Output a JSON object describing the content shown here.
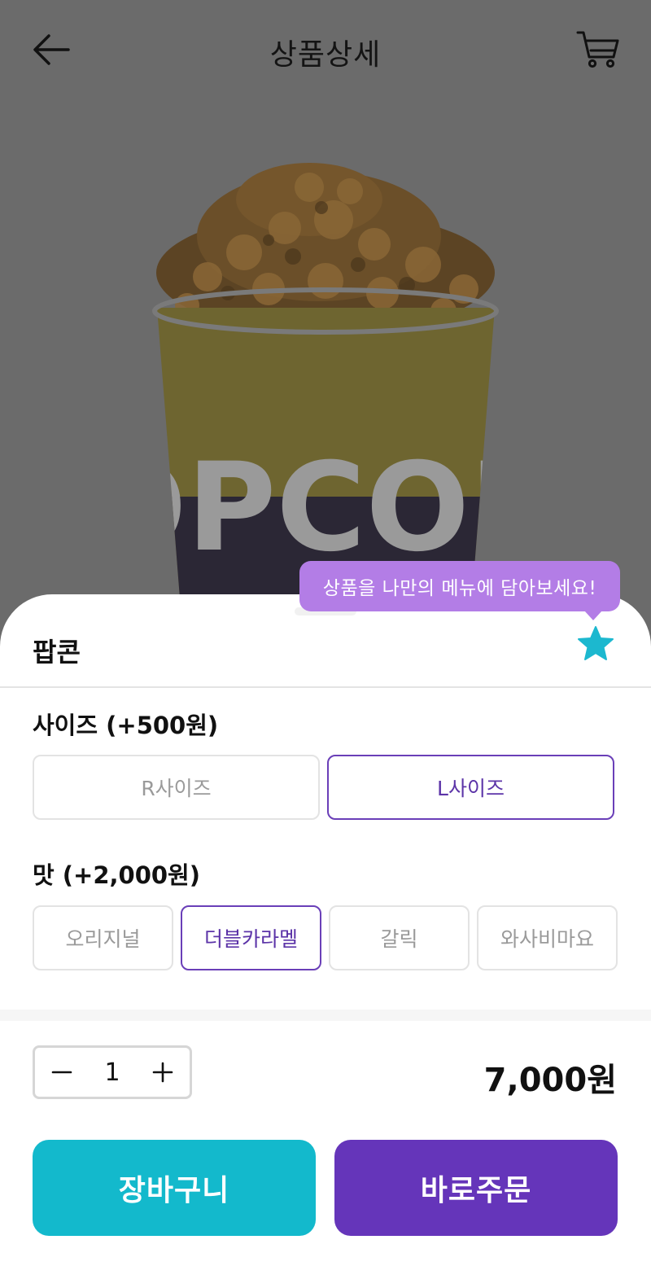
{
  "header": {
    "title": "상품상세",
    "back_icon": "arrow-left-icon",
    "cart_icon": "cart-icon"
  },
  "hero": {
    "cup_text": "POPCORN"
  },
  "tooltip": {
    "text": "상품을 나만의 메뉴에 담아보세요!"
  },
  "product": {
    "name": "팝콘",
    "favorite_icon": "star-icon"
  },
  "size": {
    "label": "사이즈 (+500원)",
    "options": [
      {
        "label": "R사이즈",
        "selected": false
      },
      {
        "label": "L사이즈",
        "selected": true
      }
    ]
  },
  "flavor": {
    "label": "맛 (+2,000원)",
    "options": [
      {
        "label": "오리지널",
        "selected": false
      },
      {
        "label": "더블카라멜",
        "selected": true
      },
      {
        "label": "갈릭",
        "selected": false
      },
      {
        "label": "와사비마요",
        "selected": false
      }
    ]
  },
  "quantity": {
    "value": "1",
    "decrement_icon": "minus-icon",
    "increment_icon": "plus-icon"
  },
  "price": {
    "total": "7,000원"
  },
  "actions": {
    "cart_label": "장바구니",
    "order_label": "바로주문"
  },
  "colors": {
    "accent_purple": "#6535ba",
    "accent_teal": "#13b9cc",
    "tooltip_purple": "#b37de6",
    "overlay_gray": "#6b6b6b"
  }
}
